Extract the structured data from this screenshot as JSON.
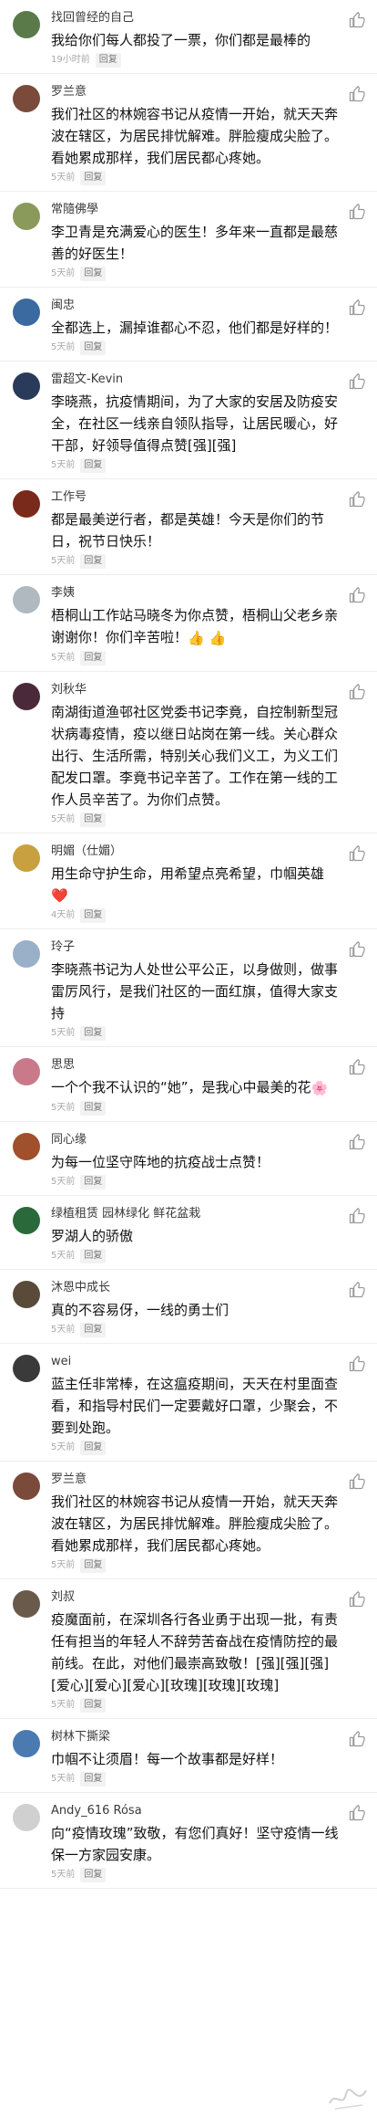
{
  "comments": [
    {
      "name": "找回曾经的自己",
      "text": "我给你们每人都投了一票，你们都是最棒的",
      "time": "19小时前",
      "reply": "回复",
      "avatar_color": "#5b7a4a"
    },
    {
      "name": "罗兰意",
      "text": "我们社区的林婉容书记从疫情一开始，就天天奔波在辖区，为居民排忧解难。胖脸瘦成尖脸了。看她累成那样，我们居民都心疼她。",
      "time": "5天前",
      "reply": "回复",
      "avatar_color": "#7a4a3a"
    },
    {
      "name": "常隨佛學",
      "text": "李卫青是充满爱心的医生！多年来一直都是最慈善的好医生！",
      "time": "5天前",
      "reply": "回复",
      "avatar_color": "#8a9a5a"
    },
    {
      "name": "闽忠",
      "text": "全都选上，漏掉谁都心不忍，他们都是好样的！",
      "time": "5天前",
      "reply": "回复",
      "avatar_color": "#3a6aa0"
    },
    {
      "name": "雷超文-Kevin",
      "text": "李晓燕，抗疫情期间，为了大家的安居及防疫安全，在社区一线亲自领队指导，让居民暖心，好干部，好领导值得点赞[强][强]",
      "time": "5天前",
      "reply": "回复",
      "avatar_color": "#2a3a5a"
    },
    {
      "name": "工作号",
      "text": "都是最美逆行者，都是英雄！今天是你们的节日，祝节日快乐！",
      "time": "5天前",
      "reply": "回复",
      "avatar_color": "#7a2a1a"
    },
    {
      "name": "李姨",
      "text": "梧桐山工作站马晓冬为你点赞，梧桐山父老乡亲谢谢你！你们辛苦啦！",
      "emoji": "👍 👍",
      "time": "5天前",
      "reply": "回复",
      "avatar_color": "#b0b8c0"
    },
    {
      "name": "刘秋华",
      "text": "南湖街道渔邨社区党委书记李竟，自控制新型冠状病毒疫情，疫以继日站岗在第一线。关心群众出行、生活所需，特别关心我们义工，为义工们配发口罩。李竟书记辛苦了。工作在第一线的工作人员辛苦了。为你们点赞。",
      "time": "5天前",
      "reply": "回复",
      "avatar_color": "#4a2a3a"
    },
    {
      "name": "明媚（仕媚）",
      "text": "用生命守护生命，用希望点亮希望，巾帼英雄",
      "emoji": "❤️",
      "time": "4天前",
      "reply": "回复",
      "avatar_color": "#c8a040"
    },
    {
      "name": "玲子",
      "text": "李晓燕书记为人处世公平公正，以身做则，做事雷厉风行，是我们社区的一面红旗，值得大家支持",
      "time": "5天前",
      "reply": "回复",
      "avatar_color": "#9ab0c8"
    },
    {
      "name": "思思",
      "text": "一个个我不认识的“她”，是我心中最美的花",
      "emoji": "🌸",
      "time": "5天前",
      "reply": "回复",
      "avatar_color": "#c87a8a"
    },
    {
      "name": "同心缘",
      "text": "为每一位坚守阵地的抗疫战士点赞！",
      "time": "5天前",
      "reply": "回复",
      "avatar_color": "#a0502a"
    },
    {
      "name": "绿植租赁 园林绿化 鲜花盆栽",
      "text": "罗湖人的骄傲",
      "time": "5天前",
      "reply": "回复",
      "avatar_color": "#2a6a3a"
    },
    {
      "name": "沐恩中成长",
      "text": "真的不容易伢，一线的勇士们",
      "time": "5天前",
      "reply": "回复",
      "avatar_color": "#5a4a3a"
    },
    {
      "name": "wei",
      "text": "蓝主任非常棒，在这瘟疫期间，天天在村里面查看，和指导村民们一定要戴好口罩，少聚会，不要到处跑。",
      "time": "5天前",
      "reply": "回复",
      "avatar_color": "#3a3a3a"
    },
    {
      "name": "罗兰意",
      "text": "我们社区的林婉容书记从疫情一开始，就天天奔波在辖区，为居民排忧解难。胖脸瘦成尖脸了。看她累成那样，我们居民都心疼她。",
      "time": "5天前",
      "reply": "回复",
      "avatar_color": "#7a4a3a"
    },
    {
      "name": "刘叔",
      "text": "疫魔面前，在深圳各行各业勇于出现一批，有责任有担当的年轻人不辞劳苦奋战在疫情防控的最前线。在此，对他们最崇高致敬！[强][强][强][爱心][爱心][爱心][玫瑰][玫瑰][玫瑰]",
      "time": "5天前",
      "reply": "回复",
      "avatar_color": "#6a5a4a"
    },
    {
      "name": "树林下撕梁",
      "text": "巾帼不让须眉！每一个故事都是好样！",
      "time": "5天前",
      "reply": "回复",
      "avatar_color": "#4a7ab0"
    },
    {
      "name": "Andy_616 Rósa",
      "text": "向“疫情玫瑰”致敬，有您们真好！坚守疫情一线保一方家园安康。",
      "time": "5天前",
      "reply": "回复",
      "avatar_color": "#d0d0d0"
    }
  ],
  "icons": {
    "like": "thumbs-up-icon"
  }
}
